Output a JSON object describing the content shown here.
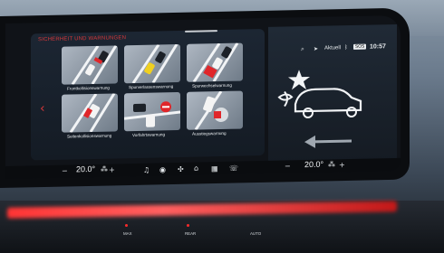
{
  "header": {
    "section_title": "SICHERHEIT UND WARNUNGEN"
  },
  "tiles": [
    {
      "label": "Frontkollisionswarnung"
    },
    {
      "label": "Spurverlassenswarnung"
    },
    {
      "label": "Spurwechselwarnung"
    },
    {
      "label": "Seitenkollisionswarnung"
    },
    {
      "label": "Vorfahrtswarnung"
    },
    {
      "label": "Ausstiegswarnung"
    }
  ],
  "status_bar": {
    "mode": "Aktuell",
    "badge": "SOS",
    "time": "10:57"
  },
  "climate": {
    "left_temp": "20.0°",
    "right_temp": "20.0°",
    "minus": "−",
    "plus": "+"
  },
  "colors": {
    "accent": "#d8383a",
    "ambient": "#ff3434"
  },
  "icons": [
    "back-arrow-icon",
    "music-icon",
    "media-icon",
    "fan-icon",
    "home-icon",
    "apps-icon",
    "phone-icon",
    "signal-icon",
    "bluetooth-icon",
    "seat-heat-icon"
  ],
  "console": {
    "labels": [
      "MAX",
      "REAR",
      "AUTO"
    ]
  }
}
